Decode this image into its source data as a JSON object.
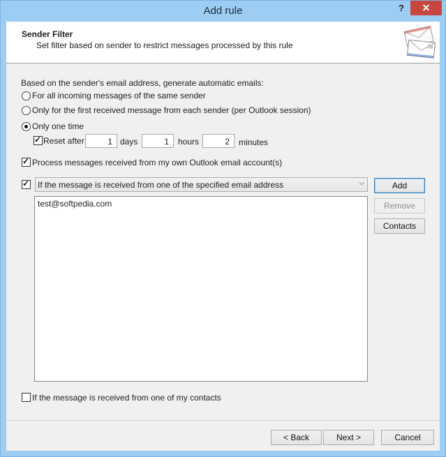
{
  "window": {
    "title": "Add rule",
    "help_label": "?",
    "close_label": "✕"
  },
  "header": {
    "title": "Sender Filter",
    "subtitle": "Set filter based on sender to restrict messages processed by this rule",
    "icon": "envelopes-icon"
  },
  "filter": {
    "intro": "Based on the sender's email address, generate automatic emails:",
    "options": [
      {
        "label": "For all incoming messages of the same sender",
        "selected": false
      },
      {
        "label": "Only for the first received message from each sender (per Outlook session)",
        "selected": false
      },
      {
        "label": "Only one time",
        "selected": true
      }
    ],
    "reset": {
      "label": "Reset after",
      "checked": true,
      "days_value": "1",
      "days_label": "days",
      "hours_value": "1",
      "hours_label": "hours",
      "minutes_value": "2",
      "minutes_label": "minutes"
    },
    "own_account": {
      "label": "Process messages received from my own Outlook email account(s)",
      "checked": true
    },
    "address_filter": {
      "checked": true,
      "selected": "If the message is received from one of the specified email address",
      "addresses": [
        "test@softpedia.com"
      ]
    },
    "buttons": {
      "add": "Add",
      "remove": "Remove",
      "contacts": "Contacts"
    },
    "contacts_only": {
      "label": "If the message is received from one of my contacts",
      "checked": false
    }
  },
  "footer": {
    "back": "< Back",
    "next": "Next >",
    "cancel": "Cancel"
  },
  "colors": {
    "titlebar": "#9dcdf3",
    "close": "#c7463d",
    "client": "#f0f0f0"
  }
}
